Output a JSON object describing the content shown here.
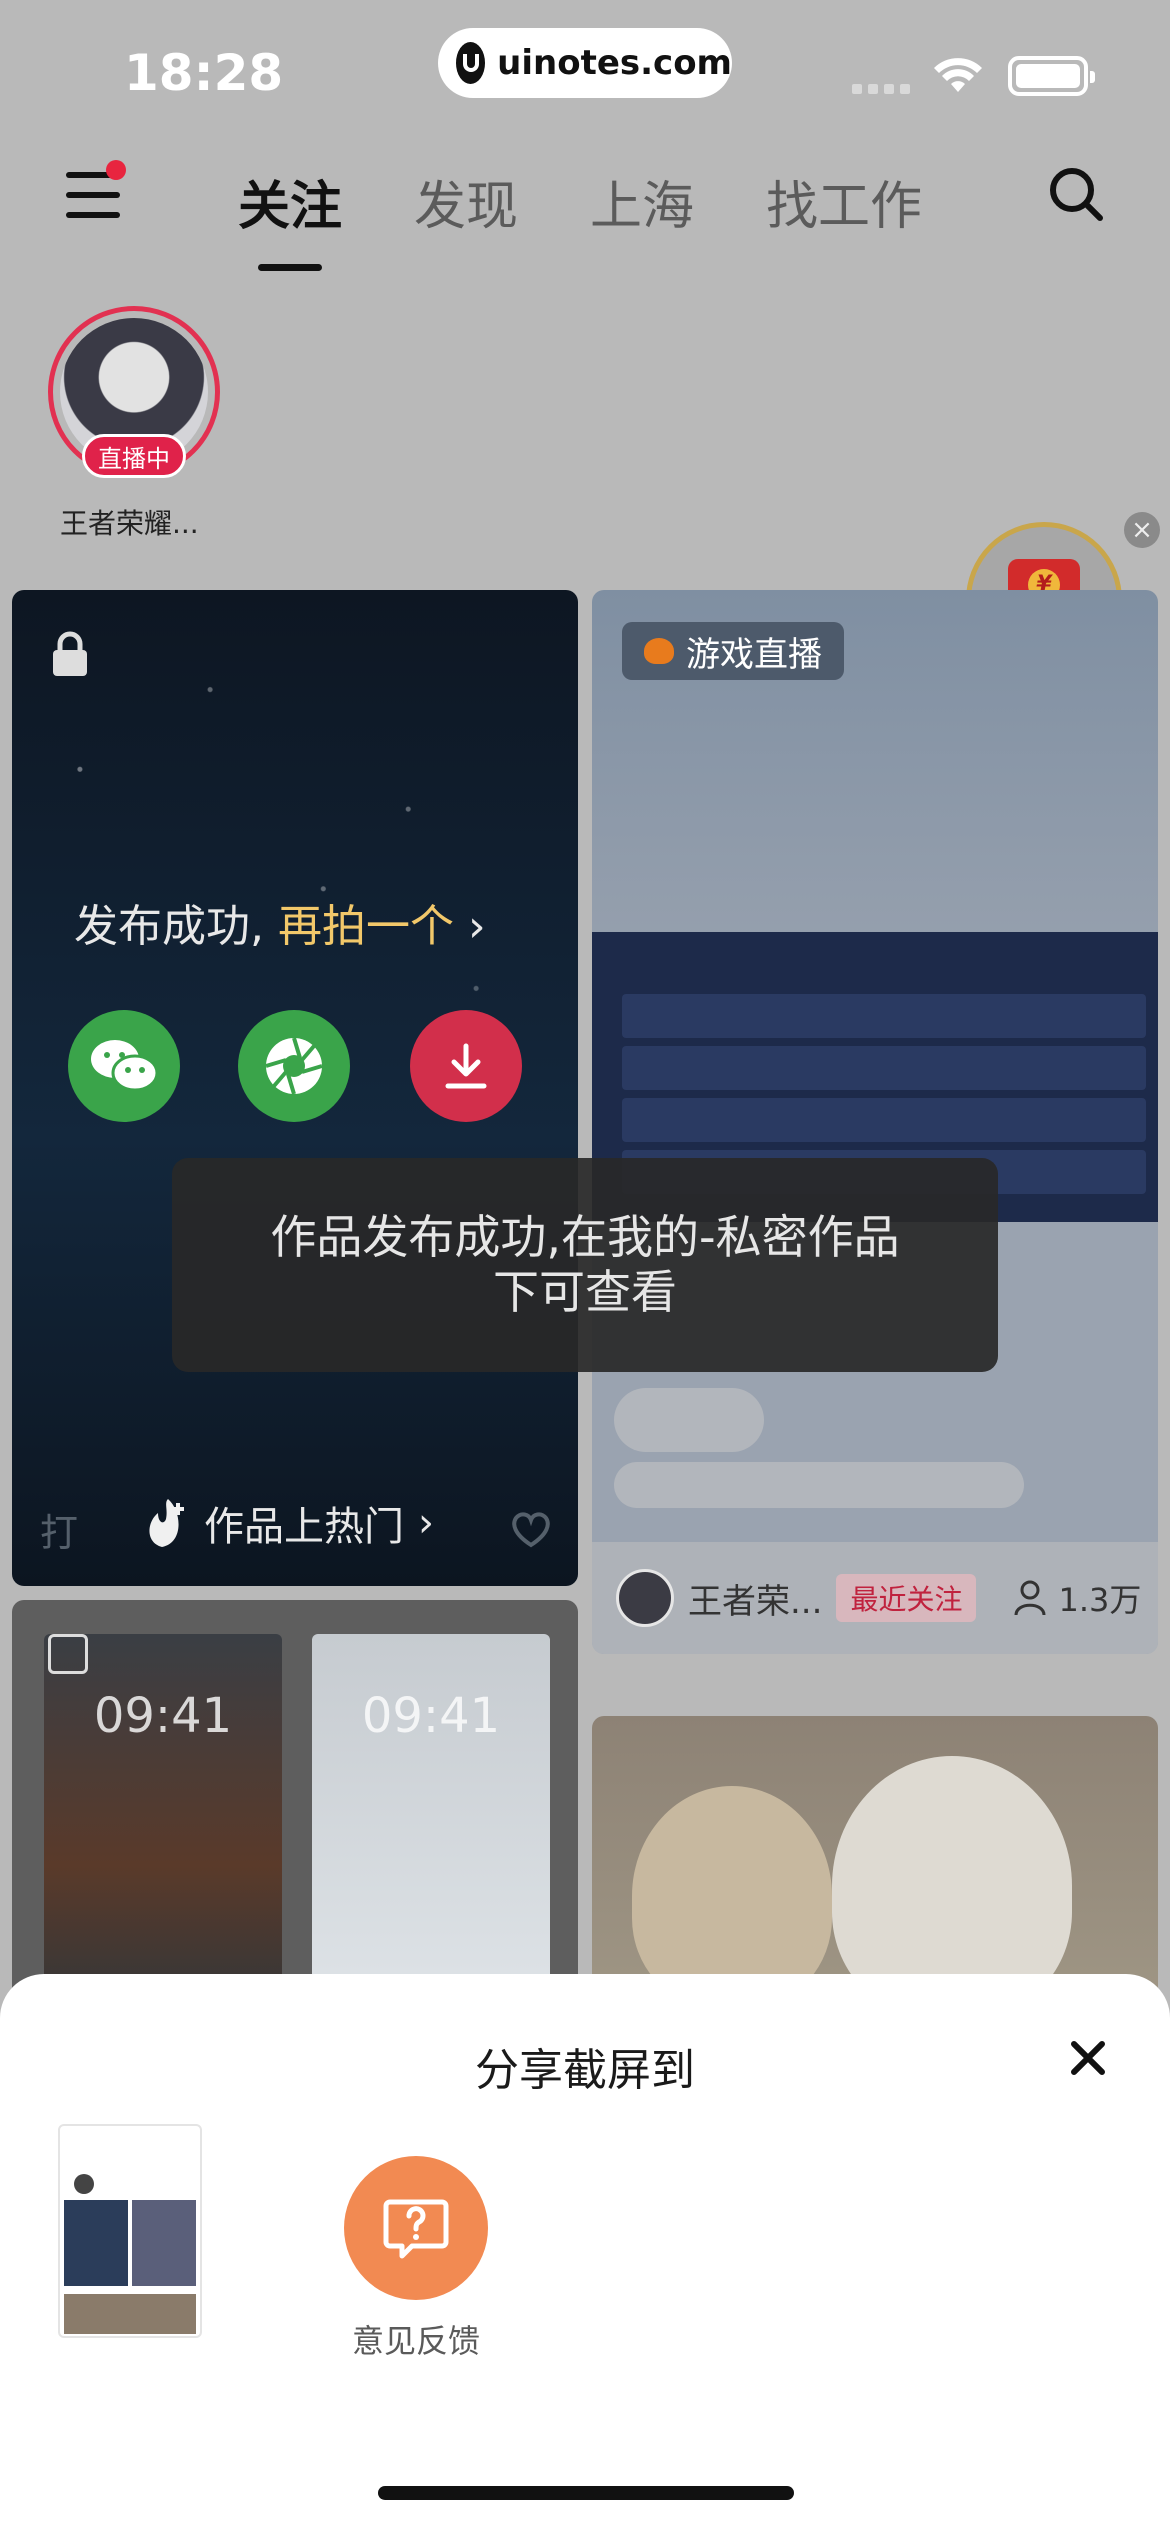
{
  "status_bar": {
    "time": "18:28",
    "url": "uinotes.com"
  },
  "nav": {
    "tabs": [
      {
        "label": "关注",
        "active": true
      },
      {
        "label": "发现",
        "active": false
      },
      {
        "label": "上海",
        "active": false
      },
      {
        "label": "找工作",
        "active": false
      }
    ]
  },
  "following": {
    "live_badge": "直播中",
    "name": "王者荣耀..."
  },
  "card_publish": {
    "title": "发布成功,",
    "title_link": "再拍一个",
    "hot_label": "作品上热门",
    "footer_name": "打"
  },
  "card_game": {
    "tag": "游戏直播",
    "author": "王者荣...",
    "follow_badge": "最近关注",
    "viewer_count": "1.3万"
  },
  "card_wallpaper": {
    "time_left": "09:41",
    "time_right": "09:41"
  },
  "toast": {
    "line1": "作品发布成功,在我的-私密作品",
    "line2": "下可查看"
  },
  "share_sheet": {
    "title": "分享截屏到",
    "feedback_label": "意见反馈"
  },
  "colors": {
    "accent_red": "#e0224a",
    "wechat_green": "#3aa44a",
    "feedback_orange": "#f28a52"
  }
}
